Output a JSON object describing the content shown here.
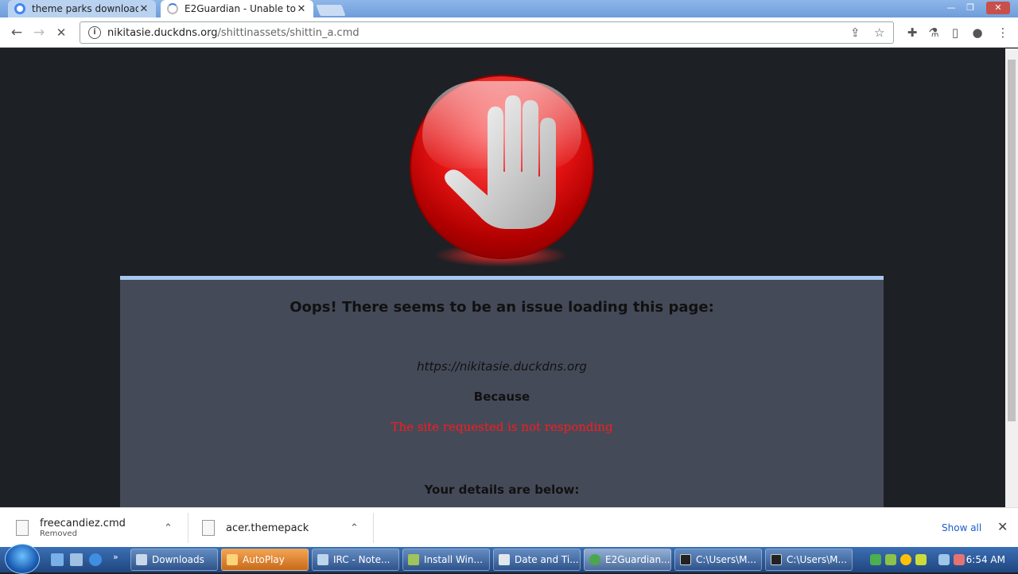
{
  "browser": {
    "tabs": [
      {
        "title": "theme parks downloads",
        "icon": "google-icon",
        "close": "✕"
      },
      {
        "title": "E2Guardian - Unable to",
        "icon": "loading-spinner-icon",
        "close": "✕"
      }
    ],
    "window_controls": {
      "minimize": "—",
      "restore": "❐",
      "close": "✕"
    },
    "toolbar": {
      "back": "←",
      "forward": "→",
      "stop": "✕",
      "url_host": "nikitasie.duckdns.org",
      "url_path": "/shittinassets/shittin_a.cmd",
      "share": "⇪",
      "bookmark": "☆",
      "extensions": "✚",
      "labs": "⚗",
      "sidepanel": "▯",
      "profile": "●",
      "menu": "⋮"
    }
  },
  "page": {
    "heading": "Oops! There seems to be an issue loading this page:",
    "site": "https://nikitasie.duckdns.org",
    "because": "Because",
    "reason": "The site requested is not responding",
    "details": "Your details are below:",
    "accent_color": "#a7c7f0",
    "reason_color": "#ff1a1a"
  },
  "downloads": {
    "items": [
      {
        "name": "freecandiez.cmd",
        "status": "Removed",
        "chevron": "⌃"
      },
      {
        "name": "acer.themepack",
        "status": "",
        "chevron": "⌃"
      }
    ],
    "show_all": "Show all",
    "close": "✕"
  },
  "taskbar": {
    "overflow": "»",
    "tasks": [
      {
        "label": "Downloads",
        "color": "#c9d8e8"
      },
      {
        "label": "AutoPlay",
        "color": "#ffd37a"
      },
      {
        "label": "IRC - Note...",
        "color": "#bcd4ee"
      },
      {
        "label": "Install Win...",
        "color": "#9fc45b"
      },
      {
        "label": "Date and Ti...",
        "color": "#e0e6ee"
      },
      {
        "label": "E2Guardian...",
        "color": "#4da64d"
      },
      {
        "label": "C:\\Users\\M...",
        "color": "#222222"
      },
      {
        "label": "C:\\Users\\M...",
        "color": "#222222"
      }
    ],
    "clock": "6:54 AM"
  }
}
